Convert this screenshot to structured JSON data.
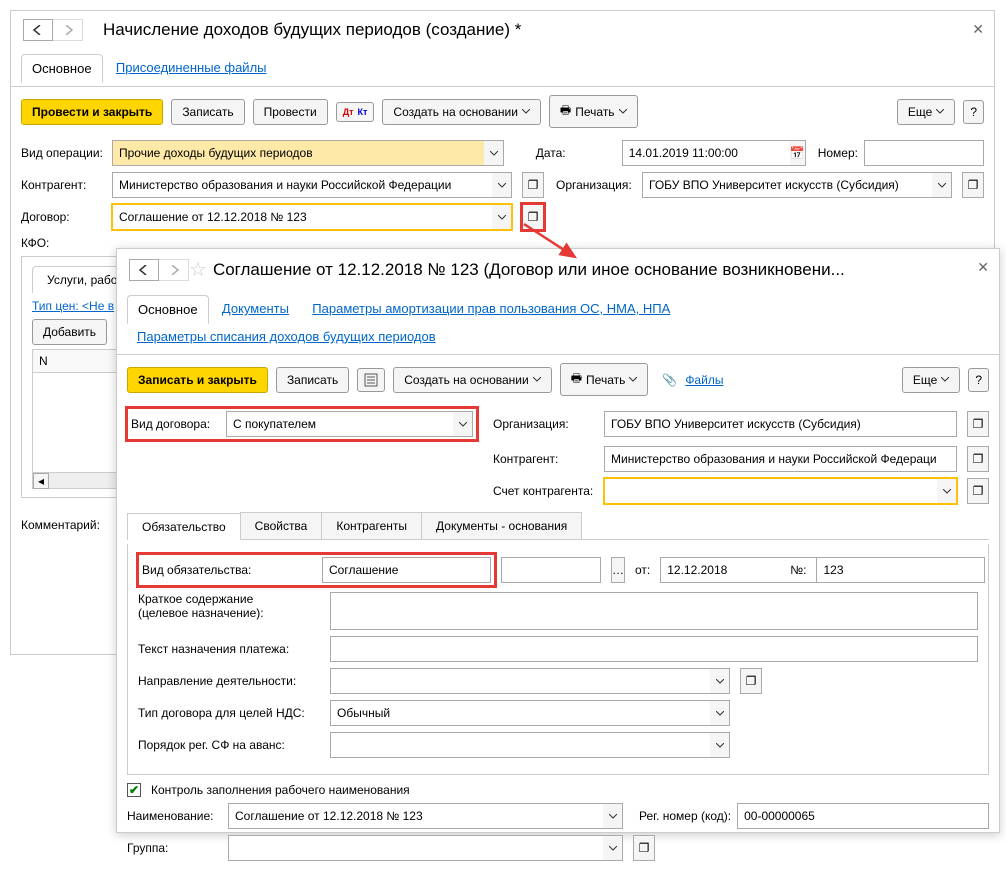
{
  "win1": {
    "title": "Начисление доходов будущих периодов (создание) *",
    "tabs": {
      "main": "Основное",
      "files": "Присоединенные файлы"
    },
    "toolbar": {
      "post_close": "Провести и закрыть",
      "save": "Записать",
      "post": "Провести",
      "create_based": "Создать на основании",
      "print": "Печать",
      "more": "Еще"
    },
    "fields": {
      "op_type_lbl": "Вид операции:",
      "op_type_val": "Прочие доходы будущих периодов",
      "date_lbl": "Дата:",
      "date_val": "14.01.2019 11:00:00",
      "num_lbl": "Номер:",
      "num_val": "",
      "counterparty_lbl": "Контрагент:",
      "counterparty_val": "Министерство образования и науки Российской Федерации",
      "org_lbl": "Организация:",
      "org_val": "ГОБУ ВПО Университет искусств (Субсидия)",
      "contract_lbl": "Договор:",
      "contract_val": "Соглашение от 12.12.2018 № 123",
      "kfo_lbl": "КФО:"
    },
    "services_tab": "Услуги, работы",
    "price_type": "Тип цен: <Не в",
    "add_btn": "Добавить",
    "col_n": "N",
    "comment_lbl": "Комментарий:"
  },
  "win2": {
    "title": "Соглашение от 12.12.2018 № 123 (Договор или иное основание возникновени...",
    "tabs": {
      "main": "Основное",
      "docs": "Документы",
      "amort": "Параметры амортизации прав пользования ОС, НМА, НПА",
      "writeoff": "Параметры списания доходов будущих периодов"
    },
    "toolbar": {
      "save_close": "Записать и закрыть",
      "save": "Записать",
      "create_based": "Создать на основании",
      "print": "Печать",
      "files": "Файлы",
      "more": "Еще"
    },
    "fields": {
      "contract_type_lbl": "Вид договора:",
      "contract_type_val": "С покупателем",
      "org_lbl": "Организация:",
      "org_val": "ГОБУ ВПО Университет искусств (Субсидия)",
      "counterparty_lbl": "Контрагент:",
      "counterparty_val": "Министерство образования и науки Российской Федераци",
      "account_lbl": "Счет контрагента:",
      "account_val": ""
    },
    "subtabs": {
      "obligation": "Обязательство",
      "props": "Свойства",
      "counterparties": "Контрагенты",
      "basis": "Документы - основания"
    },
    "panel": {
      "obl_type_lbl": "Вид обязательства:",
      "obl_type_val": "Соглашение",
      "from_lbl": "от:",
      "from_val": "12.12.2018",
      "num_lbl": "№:",
      "num_val": "123",
      "summary_lbl1": "Краткое содержание",
      "summary_lbl2": "(целевое назначение):",
      "payment_lbl": "Текст назначения платежа:",
      "activity_lbl": "Направление деятельности:",
      "vat_lbl": "Тип договора для целей НДС:",
      "vat_val": "Обычный",
      "advance_lbl": "Порядок рег. СФ на аванс:"
    },
    "check_lbl": "Контроль заполнения рабочего наименования",
    "name_lbl": "Наименование:",
    "name_val": "Соглашение от 12.12.2018 № 123",
    "reg_lbl": "Рег. номер (код):",
    "reg_val": "00-00000065",
    "group_lbl": "Группа:"
  }
}
